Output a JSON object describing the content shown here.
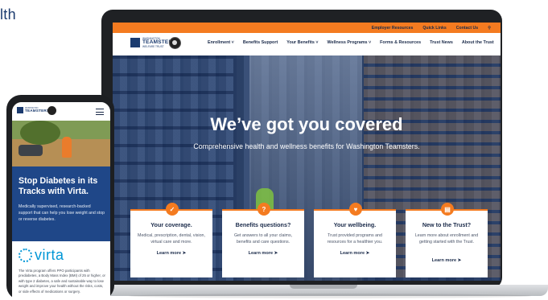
{
  "corner": {
    "text": "lth"
  },
  "desktop": {
    "utility_links": [
      "Employer Resources",
      "Quick Links",
      "Contact Us"
    ],
    "utility_search_icon": "search-icon",
    "logo": {
      "small": "WASHINGTON",
      "big": "TEAMSTERS",
      "tag": "WELFARE TRUST"
    },
    "nav": [
      "Enrollment ˅",
      "Benefits Support",
      "Your Benefits ˅",
      "Wellness Programs ˅",
      "Forms & Resources",
      "Trust News",
      "About the Trust"
    ],
    "hero": {
      "title": "We’ve got you covered",
      "subtitle": "Comprehensive health and wellness benefits for Washington Teamsters."
    },
    "cards": [
      {
        "icon": "shield-icon",
        "title": "Your coverage.",
        "body": "Medical, prescription, dental, vision, virtual care and more.",
        "link": "Learn more ➤"
      },
      {
        "icon": "question-icon",
        "title": "Benefits questions?",
        "body": "Get answers to all your claims, benefits and care questions.",
        "link": "Learn more ➤"
      },
      {
        "icon": "heart-hand-icon",
        "title": "Your wellbeing.",
        "body": "Trust provided programs and resources for a healthier you.",
        "link": "Learn more ➤"
      },
      {
        "icon": "book-icon",
        "title": "New to the Trust?",
        "body": "Learn more about enrollment and getting started with the Trust.",
        "link": "Learn more ➤"
      }
    ],
    "accent_color": "#f47b20",
    "brand_color": "#1b3b6f"
  },
  "mobile": {
    "logo": {
      "small": "WASHINGTON",
      "big": "TEAMSTERS"
    },
    "menu_icon": "hamburger-menu-icon",
    "hero_title": "Stop Diabetes in its Tracks with Virta.",
    "hero_body": "Medically supervised, research-backed support that can help you lose weight and stop or reverse diabetes.",
    "virta_word": "virta",
    "virta_desc": "The Virta program offers PPO participants with prediabetes, a Body Mass Index (BMI) of 25 or higher, or with type 2 diabetes, a safe and sustainable way to lose weight and improve your health without the risks, costs, or side effects of medications or surgery.",
    "hero_color": "#1f4788",
    "virta_color": "#0096d6"
  }
}
